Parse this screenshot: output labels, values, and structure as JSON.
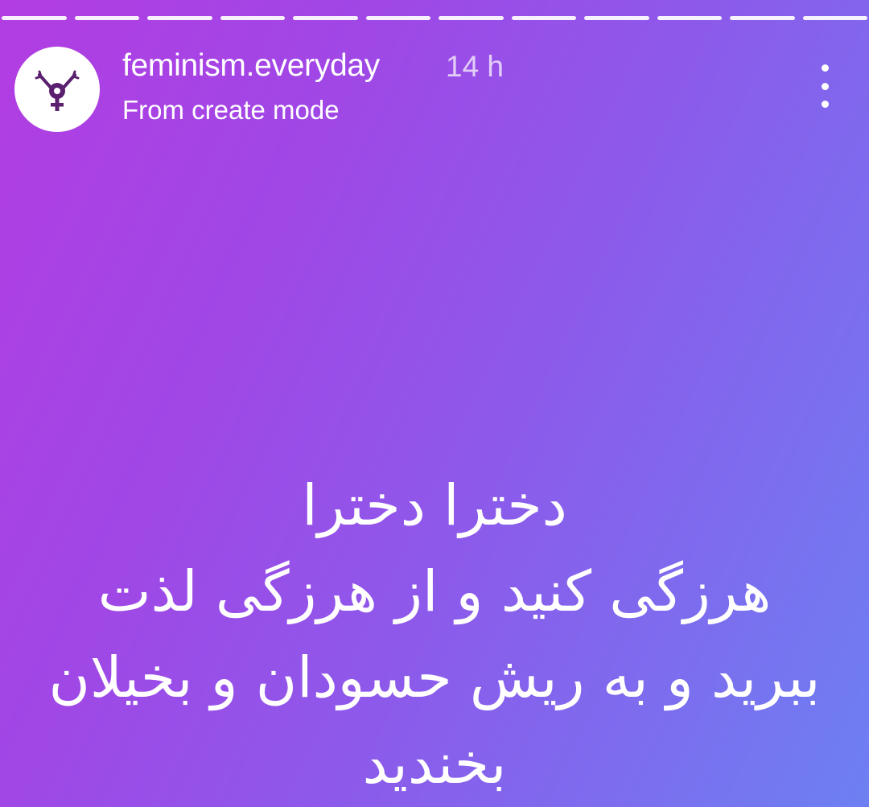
{
  "story": {
    "segment_count": 12,
    "username": "feminism.everyday",
    "time_ago": "14 h",
    "subtitle": "From create mode",
    "avatar_icon": "venus-symbol-icon",
    "more_icon": "more-options-icon",
    "text_lines": [
      "دخترا دخترا",
      "هرزگی کنید و از هرزگی لذت",
      "ببرید و به ریش حسودان و بخیلان",
      "بخندید"
    ],
    "colors": {
      "gradient_start": "#b23de2",
      "gradient_end": "#6d80f2",
      "avatar_mark": "#5a1f6e"
    }
  }
}
